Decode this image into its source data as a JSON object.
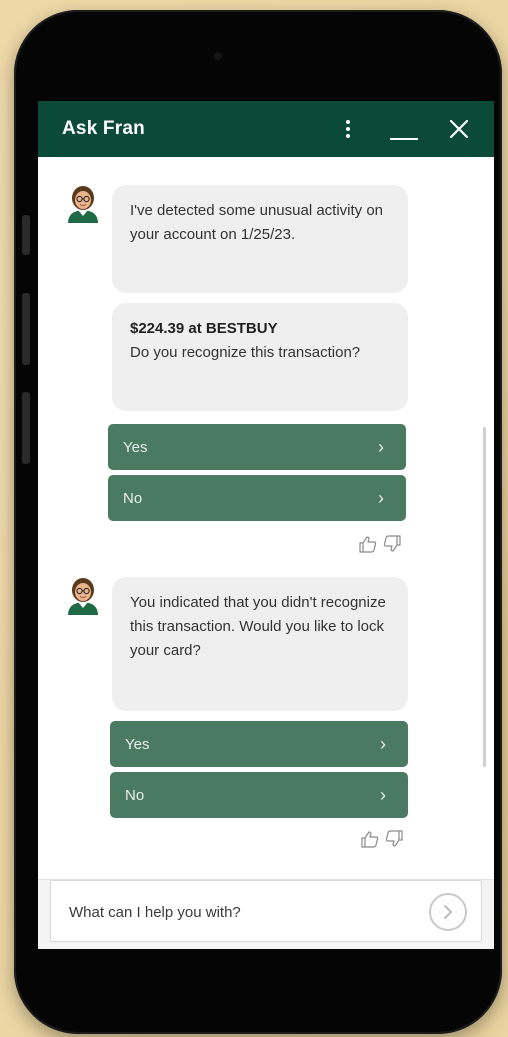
{
  "header": {
    "title": "Ask Fran"
  },
  "messages": [
    {
      "sender": "bot",
      "bubbles": [
        {
          "text": "I've detected some unusual activity on your account on 1/25/23."
        },
        {
          "strong": "$224.39 at BESTBUY",
          "text": "Do you recognize this transaction?"
        }
      ],
      "options": [
        {
          "label": "Yes"
        },
        {
          "label": "No"
        }
      ]
    },
    {
      "sender": "bot",
      "bubbles": [
        {
          "text": "You indicated that you didn't recognize this transaction. Would you like to lock your card?"
        }
      ],
      "options": [
        {
          "label": "Yes"
        },
        {
          "label": "No"
        }
      ]
    }
  ],
  "composer": {
    "placeholder": "What can I help you with?"
  },
  "colors": {
    "header_bg": "#0b4a36",
    "option_bg": "#4b7a62",
    "bubble_bg": "#efefef"
  },
  "icons": {
    "avatar": "avatar-icon",
    "kebab": "kebab-menu-icon",
    "minimize": "minimize-icon",
    "close": "close-icon",
    "chevron": "chevron-right-icon",
    "thumbs_up": "thumbs-up-icon",
    "thumbs_down": "thumbs-down-icon",
    "send": "send-icon"
  }
}
